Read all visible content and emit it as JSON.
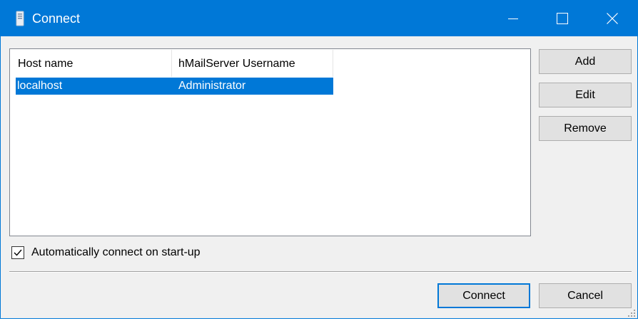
{
  "window": {
    "title": "Connect",
    "accent_color": "#0078d7",
    "icons": [
      "server-icon",
      "minimize-icon",
      "maximize-icon",
      "close-icon"
    ]
  },
  "servers_list": {
    "columns": [
      "Host name",
      "hMailServer Username"
    ],
    "rows": [
      {
        "host": "localhost",
        "username": "Administrator",
        "selected": true
      }
    ]
  },
  "side_buttons": {
    "add": "Add",
    "edit": "Edit",
    "remove": "Remove"
  },
  "auto_connect": {
    "label": "Automatically connect on start-up",
    "checked": true
  },
  "footer": {
    "connect": "Connect",
    "cancel": "Cancel"
  }
}
